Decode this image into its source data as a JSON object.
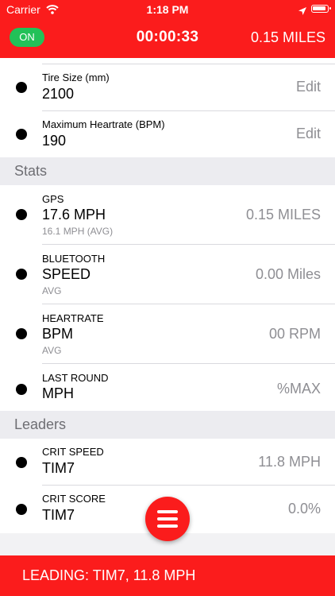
{
  "status_bar": {
    "carrier": "Carrier",
    "time": "1:18 PM"
  },
  "header": {
    "status_badge": "ON",
    "timer": "00:00:33",
    "distance": "0.15 MILES"
  },
  "settings": [
    {
      "label": "Tire Size (mm)",
      "value": "2100",
      "action": "Edit"
    },
    {
      "label": "Maximum Heartrate (BPM)",
      "value": "190",
      "action": "Edit"
    }
  ],
  "stats_header": "Stats",
  "stats": [
    {
      "label": "GPS",
      "value": "17.6 MPH",
      "sub": "16.1 MPH (AVG)",
      "right": "0.15 MILES"
    },
    {
      "label": "BLUETOOTH",
      "value": "SPEED",
      "sub": "AVG",
      "right": "0.00 Miles"
    },
    {
      "label": "HEARTRATE",
      "value": "BPM",
      "sub": "AVG",
      "right": "00 RPM"
    },
    {
      "label": "LAST ROUND",
      "value": "MPH",
      "right": "%MAX"
    }
  ],
  "leaders_header": "Leaders",
  "leaders": [
    {
      "label": "CRIT SPEED",
      "value": "TIM7",
      "right": "11.8 MPH"
    },
    {
      "label": "CRIT SCORE",
      "value": "TIM7",
      "right": "0.0%"
    }
  ],
  "footer": {
    "text": "LEADING: TIM7, 11.8 MPH"
  },
  "colors": {
    "accent": "#fb1c1c",
    "on_badge": "#22c158"
  }
}
